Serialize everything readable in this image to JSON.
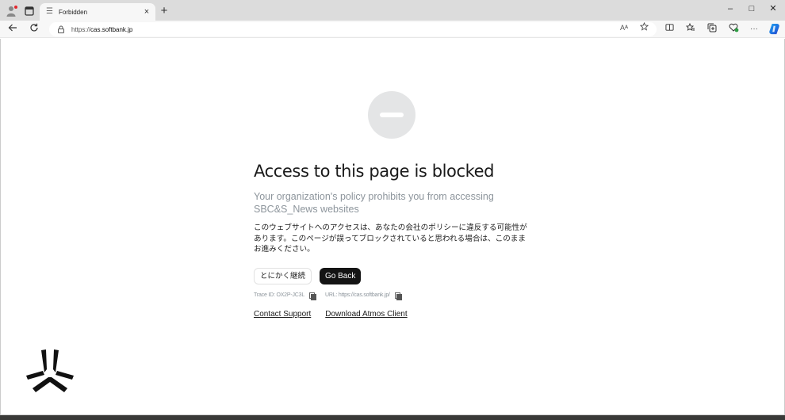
{
  "browser": {
    "tab": {
      "title": "Forbidden",
      "favicon": "list-icon",
      "close": "×"
    },
    "new_tab": "+",
    "window_controls": {
      "minimize": "–",
      "maximize": "□",
      "close": "✕"
    },
    "address": {
      "scheme": "https://",
      "host": "cas.softbank.jp"
    },
    "toolbar_icons": [
      "read-aloud-icon",
      "favorite-star-icon",
      "split-screen-icon",
      "favorites-icon",
      "collections-icon",
      "browser-essentials-icon",
      "more-icon",
      "copilot-icon"
    ],
    "read_aloud_label": "Aᴬ",
    "more_label": "···"
  },
  "page": {
    "icon": "blocked-icon",
    "title": "Access to this page is blocked",
    "subtitle": "Your organization's policy prohibits you from accessing SBC&S_News websites",
    "japanese_notice": "このウェブサイトへのアクセスは、あなたの会社のポリシーに違反する可能性があります。このページが誤ってブロックされていると思われる場合は、このままお進みください。",
    "buttons": {
      "continue": "とにかく継続",
      "go_back": "Go Back"
    },
    "trace_id": "Trace ID: OX2P-JC3L",
    "url_label": "URL: https://cas.softbank.jp/",
    "links": {
      "contact_support": "Contact Support",
      "download_client": "Download Atmos Client"
    }
  },
  "colors": {
    "accent_dark": "#141414",
    "muted_text": "#8d959c",
    "icon_bg": "#e4e5e6"
  }
}
